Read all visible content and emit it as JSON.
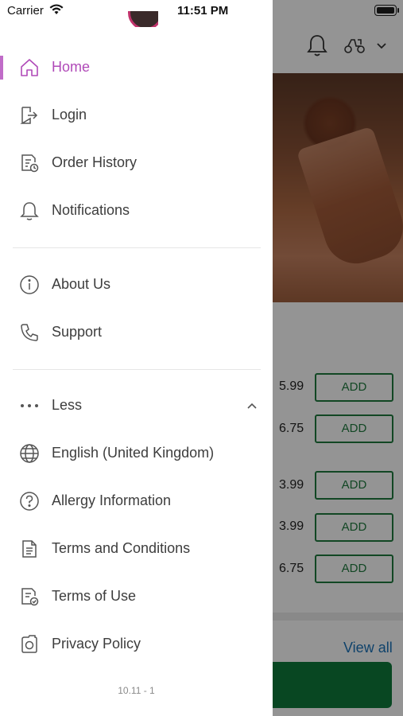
{
  "status_bar": {
    "carrier": "Carrier",
    "time": "11:51 PM"
  },
  "menu": {
    "primary": [
      {
        "label": "Home",
        "icon": "home-icon",
        "active": true
      },
      {
        "label": "Login",
        "icon": "login-icon"
      },
      {
        "label": "Order History",
        "icon": "order-history-icon"
      },
      {
        "label": "Notifications",
        "icon": "bell-icon"
      }
    ],
    "secondary": [
      {
        "label": "About Us",
        "icon": "info-icon"
      },
      {
        "label": "Support",
        "icon": "phone-icon"
      }
    ],
    "less_label": "Less",
    "more": [
      {
        "label": "English (United Kingdom)",
        "icon": "globe-icon"
      },
      {
        "label": "Allergy Information",
        "icon": "question-icon"
      },
      {
        "label": "Terms and Conditions",
        "icon": "document-icon"
      },
      {
        "label": "Terms of Use",
        "icon": "document-check-icon"
      },
      {
        "label": "Privacy Policy",
        "icon": "privacy-icon"
      }
    ],
    "version": "10.11 - 1"
  },
  "background": {
    "products": [
      {
        "price": "5.99",
        "add_label": "ADD"
      },
      {
        "price": "6.75",
        "add_label": "ADD"
      },
      {
        "price": "3.99",
        "add_label": "ADD"
      },
      {
        "price": "3.99",
        "add_label": "ADD"
      },
      {
        "price": "6.75",
        "add_label": "ADD"
      }
    ],
    "view_all": "View all"
  },
  "colors": {
    "accent": "#b04ab8",
    "add_green": "#1f7a3f",
    "link_blue": "#1a73b8"
  }
}
